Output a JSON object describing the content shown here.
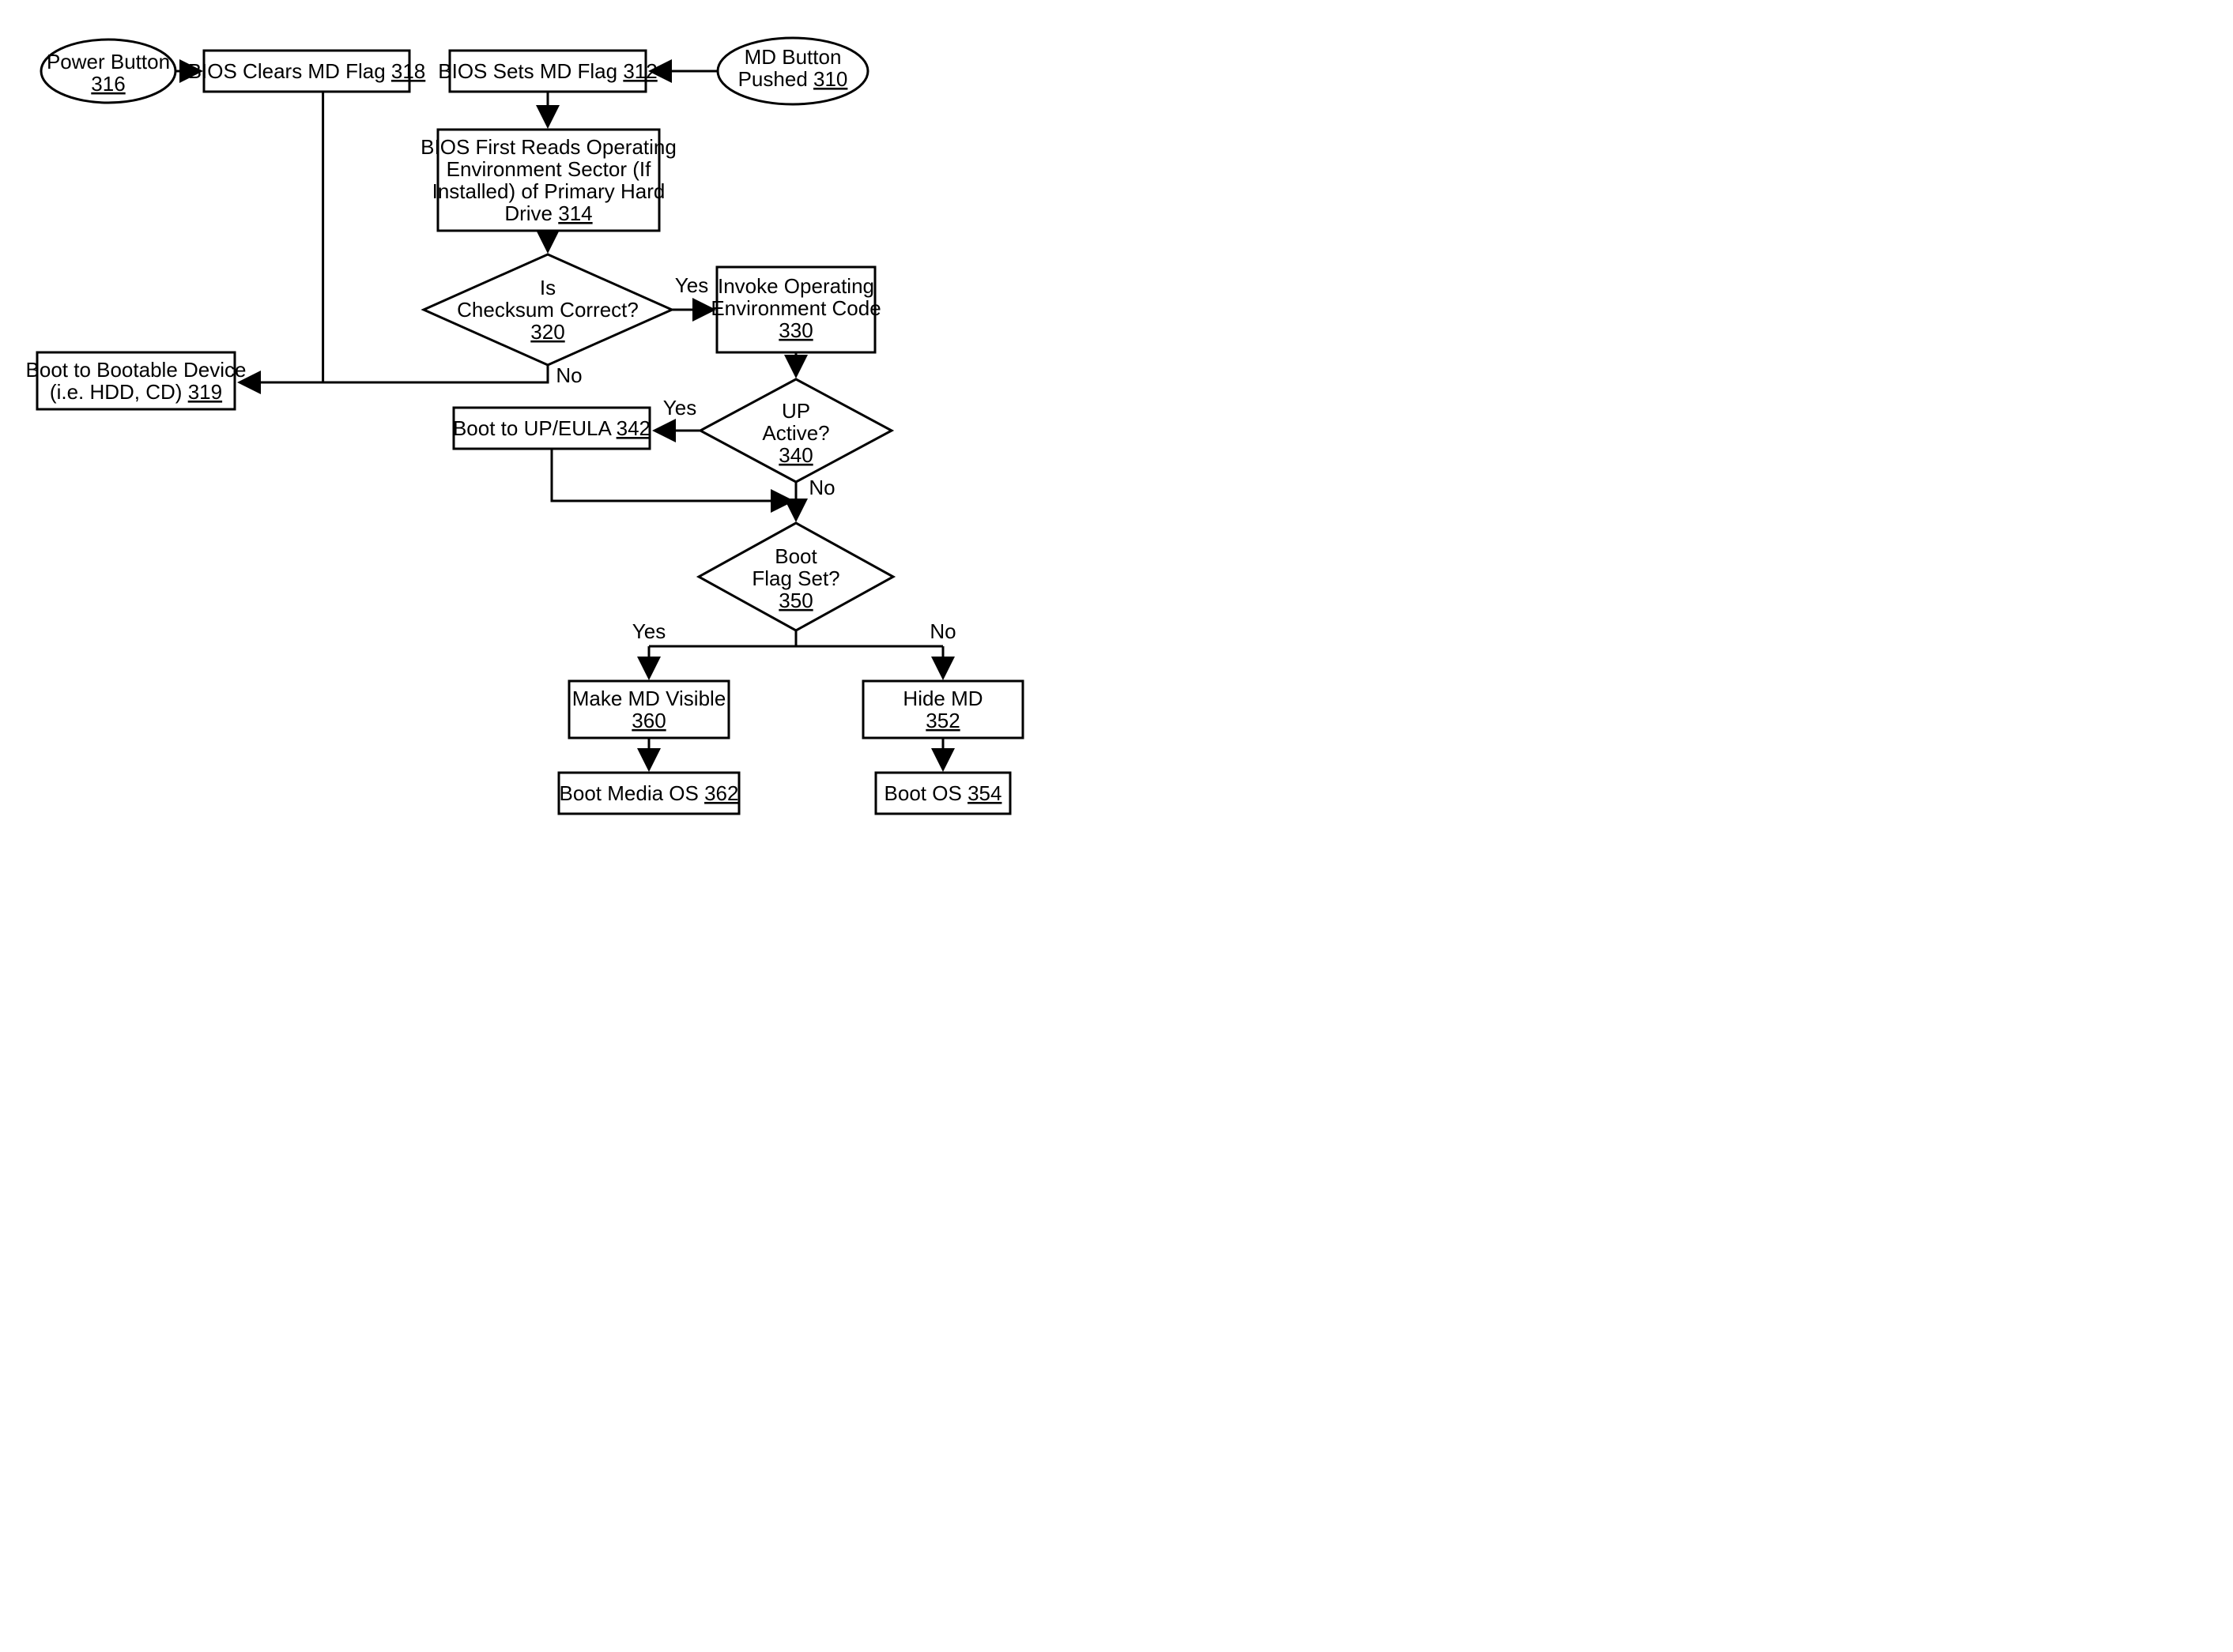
{
  "nodes": {
    "n316": {
      "text": "Power Button",
      "ref": "316"
    },
    "n318": {
      "text": "BIOS Clears MD Flag",
      "ref": "318"
    },
    "n312": {
      "text": "BIOS Sets MD Flag",
      "ref": "312"
    },
    "n310": {
      "text1": "MD Button",
      "text2": "Pushed",
      "ref": "310"
    },
    "n314": {
      "l1": "BIOS First Reads Operating",
      "l2": "Environment Sector (If",
      "l3": "Installed) of Primary Hard",
      "l4": "Drive",
      "ref": "314"
    },
    "n320": {
      "l1": "Is",
      "l2": "Checksum Correct?",
      "ref": "320"
    },
    "n330": {
      "l1": "Invoke Operating",
      "l2": "Environment Code",
      "ref": "330"
    },
    "n319": {
      "l1": "Boot to Bootable Device",
      "l2": "(i.e. HDD, CD)",
      "ref": "319"
    },
    "n342": {
      "text": "Boot to UP/EULA",
      "ref": "342"
    },
    "n340": {
      "l1": "UP",
      "l2": "Active?",
      "ref": "340"
    },
    "n350": {
      "l1": "Boot",
      "l2": "Flag Set?",
      "ref": "350"
    },
    "n360": {
      "text": "Make MD Visible",
      "ref": "360"
    },
    "n352": {
      "text": "Hide MD",
      "ref": "352"
    },
    "n362": {
      "text": "Boot Media OS",
      "ref": "362"
    },
    "n354": {
      "text": "Boot OS",
      "ref": "354"
    }
  },
  "labels": {
    "yes": "Yes",
    "no": "No"
  }
}
